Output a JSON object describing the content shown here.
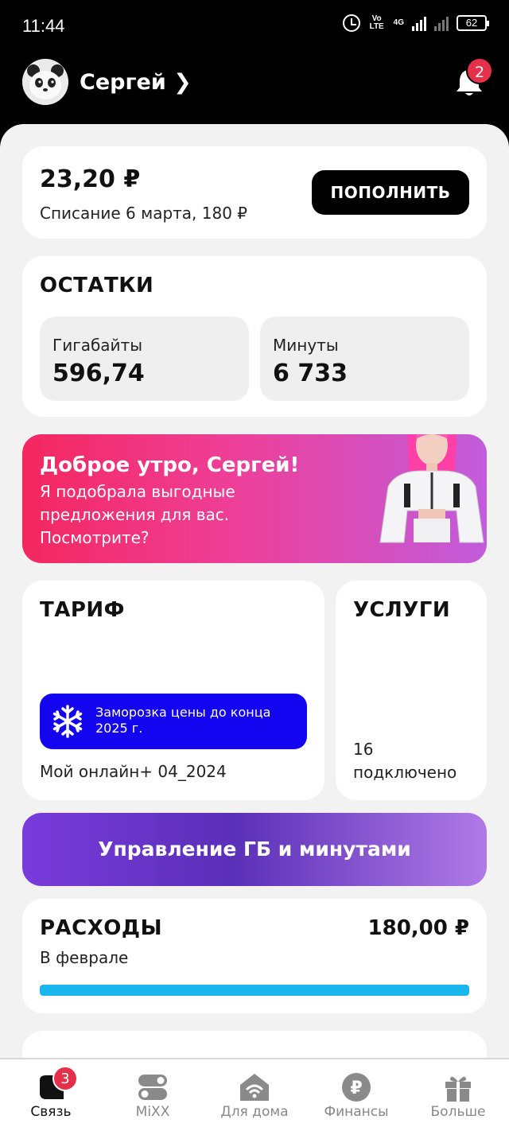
{
  "status_bar": {
    "time": "11:44",
    "network_label": "Vo LTE",
    "network_type": "4G",
    "battery": "62"
  },
  "header": {
    "user_name": "Сергей",
    "notifications_count": "2"
  },
  "balance": {
    "amount": "23,20 ₽",
    "charge_info": "Списание 6 марта, 180 ₽",
    "topup_label": "ПОПОЛНИТЬ"
  },
  "remains": {
    "title": "ОСТАТКИ",
    "items": [
      {
        "label": "Гигабайты",
        "value": "596,74"
      },
      {
        "label": "Минуты",
        "value": "6 733"
      }
    ]
  },
  "promo": {
    "title": "Доброе утро, Сергей!",
    "text": "Я подобрала выгодные предложения для вас. Посмотрите?"
  },
  "tariff": {
    "title": "ТАРИФ",
    "freeze_text": "Заморозка цены до конца 2025 г.",
    "name": "Мой онлайн+ 04_2024"
  },
  "services": {
    "title": "УСЛУГИ",
    "count_text": "16 подключено"
  },
  "manage": {
    "label": "Управление ГБ и минутами"
  },
  "expenses": {
    "title": "РАСХОДЫ",
    "amount": "180,00 ₽",
    "period": "В феврале",
    "progress": 1.0
  },
  "bottom_nav": [
    {
      "label": "Связь",
      "icon": "chat-icon",
      "badge": "3",
      "active": true
    },
    {
      "label": "MiXX",
      "icon": "mixx-icon",
      "active": false
    },
    {
      "label": "Для дома",
      "icon": "home-wifi-icon",
      "active": false
    },
    {
      "label": "Финансы",
      "icon": "ruble-icon",
      "active": false
    },
    {
      "label": "Больше",
      "icon": "gift-icon",
      "active": false
    }
  ],
  "colors": {
    "accent_blue": "#1405f0",
    "progress": "#1ab7ee",
    "badge": "#e5304a"
  }
}
